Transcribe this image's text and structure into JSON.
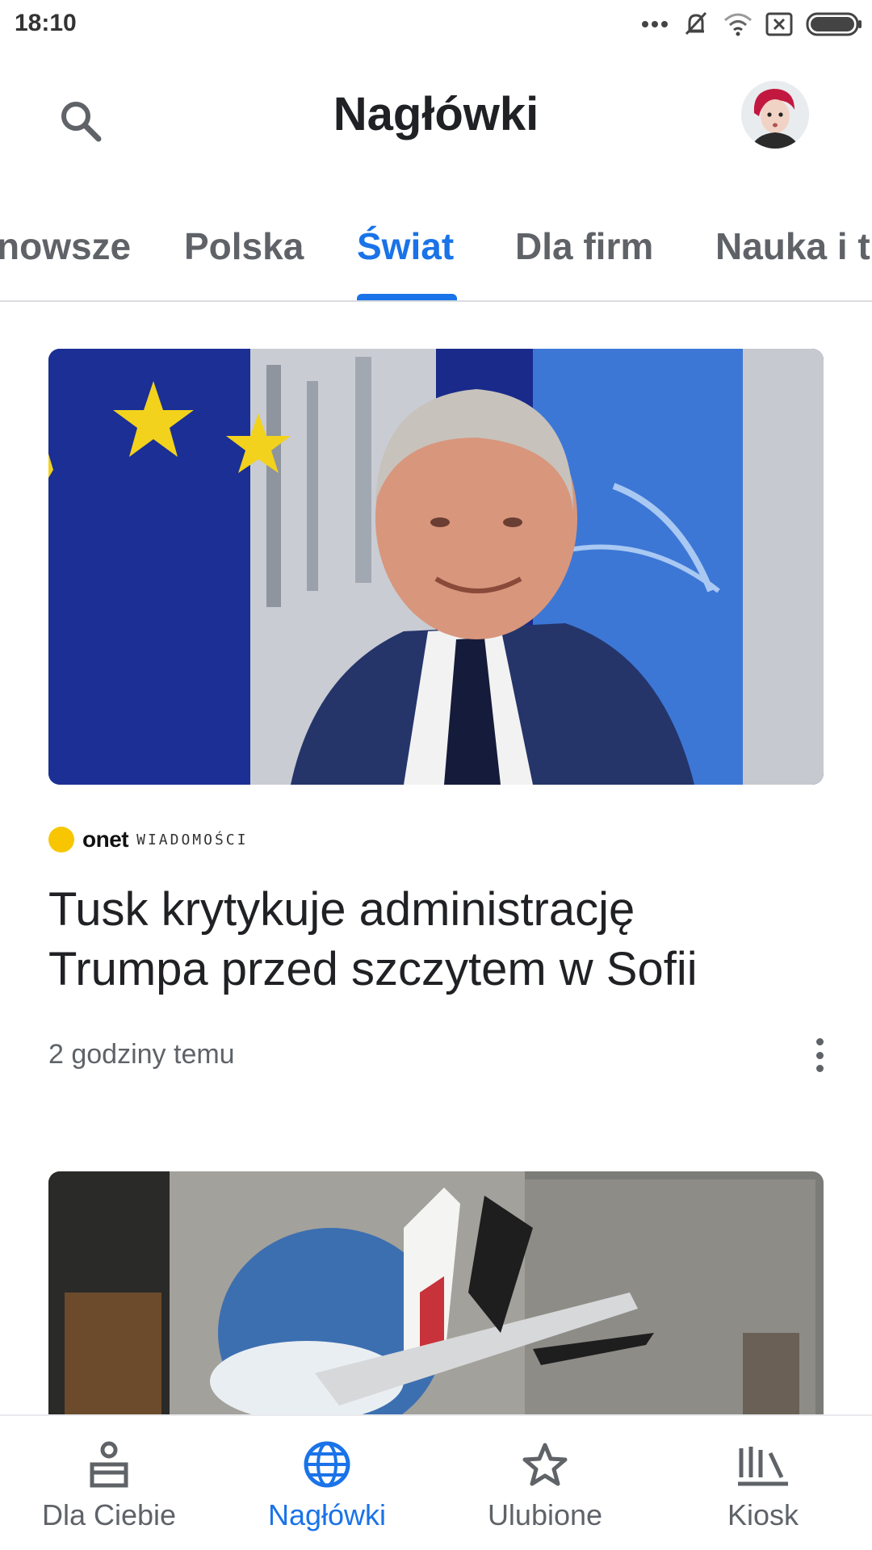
{
  "status_bar": {
    "time": "18:10"
  },
  "app_bar": {
    "title": "Nagłówki"
  },
  "tabs": [
    {
      "label": "Najnowsze",
      "shown_text": "nowsze"
    },
    {
      "label": "Polska"
    },
    {
      "label": "Świat",
      "active": true
    },
    {
      "label": "Dla firm"
    },
    {
      "label": "Nauka i t",
      "shown_text": "Nauka i t"
    }
  ],
  "feed": {
    "articles": [
      {
        "source_name": "onet",
        "source_sub": "WIADOMOŚCI",
        "headline": "Tusk krytykuje administrację Trumpa przed szczytem w Sofii",
        "time": "2 godziny temu",
        "image": "photo-tusk-eu-flags"
      },
      {
        "image": "photo-plane-mural"
      }
    ]
  },
  "bottom_nav": [
    {
      "label": "Dla Ciebie",
      "icon": "person-icon"
    },
    {
      "label": "Nagłówki",
      "icon": "globe-icon",
      "active": true
    },
    {
      "label": "Ulubione",
      "icon": "star-icon"
    },
    {
      "label": "Kiosk",
      "icon": "newsstand-icon"
    }
  ],
  "colors": {
    "accent": "#1a73e8",
    "text": "#202124",
    "muted": "#5f6368"
  }
}
